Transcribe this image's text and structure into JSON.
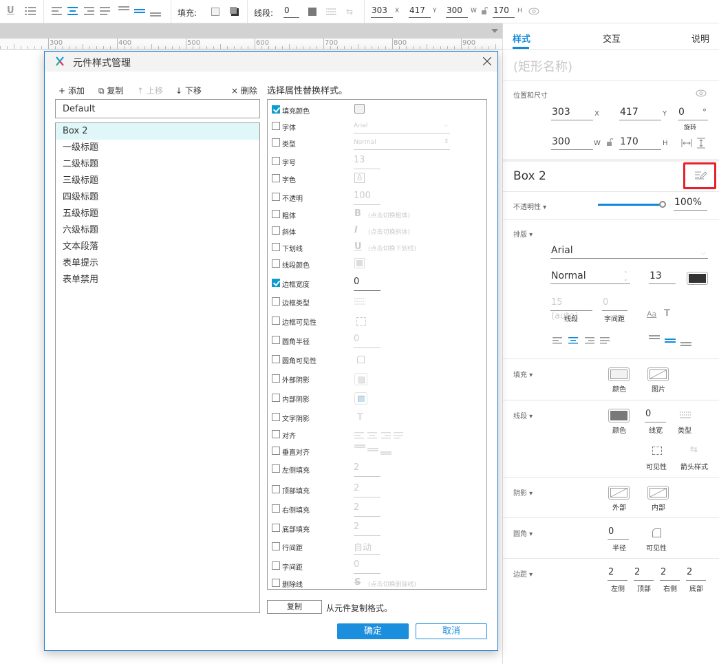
{
  "toolbar": {
    "fill_label": "填充:",
    "stroke_label": "线段:",
    "stroke_width": "0",
    "x": "303",
    "x_unit": "X",
    "y": "417",
    "y_unit": "Y",
    "w": "300",
    "w_unit": "W",
    "h": "170",
    "h_unit": "H"
  },
  "ruler": {
    "ticks": [
      "300",
      "400",
      "500",
      "600",
      "700",
      "800",
      "900"
    ]
  },
  "dialog": {
    "title": "元件样式管理",
    "tools": {
      "add": "+ 添加",
      "copy": "⧉ 复制",
      "up": "↑ 上移",
      "down": "↓ 下移",
      "delete": "× 删除"
    },
    "default_item": "Default",
    "styles": [
      "Box 2",
      "一级标题",
      "二级标题",
      "三级标题",
      "四级标题",
      "五级标题",
      "六级标题",
      "文本段落",
      "表单提示",
      "表单禁用"
    ],
    "selected_style": "Box 2",
    "prop_heading": "选择属性替换样式。",
    "props": [
      {
        "label": "填充颜色",
        "checked": true,
        "value": ""
      },
      {
        "label": "字体",
        "checked": false,
        "value": "Arial"
      },
      {
        "label": "类型",
        "checked": false,
        "value": "Normal"
      },
      {
        "label": "字号",
        "checked": false,
        "value": "13"
      },
      {
        "label": "字色",
        "checked": false,
        "value": ""
      },
      {
        "label": "不透明",
        "checked": false,
        "value": "100"
      },
      {
        "label": "粗体",
        "checked": false,
        "value": "(点击切换粗体)"
      },
      {
        "label": "斜体",
        "checked": false,
        "value": "(点击切换斜体)"
      },
      {
        "label": "下划线",
        "checked": false,
        "value": "(点击切换下划线)"
      },
      {
        "label": "线段颜色",
        "checked": false,
        "value": ""
      },
      {
        "label": "边框宽度",
        "checked": true,
        "value": "0"
      },
      {
        "label": "边框类型",
        "checked": false,
        "value": ""
      },
      {
        "label": "边框可见性",
        "checked": false,
        "value": ""
      },
      {
        "label": "圆角半径",
        "checked": false,
        "value": "0"
      },
      {
        "label": "圆角可见性",
        "checked": false,
        "value": ""
      },
      {
        "label": "外部阴影",
        "checked": false,
        "value": ""
      },
      {
        "label": "内部阴影",
        "checked": false,
        "value": ""
      },
      {
        "label": "文字阴影",
        "checked": false,
        "value": ""
      },
      {
        "label": "对齐",
        "checked": false,
        "value": ""
      },
      {
        "label": "垂直对齐",
        "checked": false,
        "value": ""
      },
      {
        "label": "左侧填充",
        "checked": false,
        "value": "2"
      },
      {
        "label": "顶部填充",
        "checked": false,
        "value": "2"
      },
      {
        "label": "右侧填充",
        "checked": false,
        "value": "2"
      },
      {
        "label": "底部填充",
        "checked": false,
        "value": "2"
      },
      {
        "label": "行间距",
        "checked": false,
        "value": "自动"
      },
      {
        "label": "字间距",
        "checked": false,
        "value": "0"
      },
      {
        "label": "删除线",
        "checked": false,
        "value": "(点击切换删除线)"
      }
    ],
    "copy_button": "复制",
    "copy_text": "从元件复制格式。",
    "ok": "确定",
    "cancel": "取消"
  },
  "panel": {
    "tabs": [
      "样式",
      "交互",
      "说明"
    ],
    "active_tab": "样式",
    "shape_name_placeholder": "(矩形名称)",
    "pos_size_label": "位置和尺寸",
    "x": "303",
    "y": "417",
    "rotation": "0",
    "w": "300",
    "h": "170",
    "x_unit": "X",
    "y_unit": "Y",
    "w_unit": "W",
    "h_unit": "H",
    "deg": "°",
    "rotate_label": "旋转",
    "style_name": "Box 2",
    "opacity_label": "不透明性 ▾",
    "opacity_value": "100%",
    "opacity_fraction": 1.0,
    "typography_label": "排版 ▾",
    "font": "Arial",
    "font_style": "Normal",
    "font_size": "13",
    "line_height": "15 (auto)",
    "letter_spacing": "0",
    "line_height_label": "线段",
    "letter_spacing_label": "字间距",
    "fill_label": "填充 ▾",
    "fill_color_label": "颜色",
    "fill_image_label": "图片",
    "stroke_label": "线段 ▾",
    "stroke_color_label": "颜色",
    "stroke_width": "0",
    "stroke_width_label": "线宽",
    "stroke_type_label": "类型",
    "stroke_visibility_label": "可见性",
    "arrow_style_label": "箭头样式",
    "shadow_label": "阴影 ▾",
    "shadow_outer_label": "外部",
    "shadow_inner_label": "内部",
    "corner_label": "圆角 ▾",
    "corner_radius": "0",
    "corner_radius_label": "半径",
    "corner_visibility_label": "可见性",
    "padding_label": "边距 ▾",
    "padding": [
      {
        "value": "2",
        "label": "左侧"
      },
      {
        "value": "2",
        "label": "顶部"
      },
      {
        "value": "2",
        "label": "右侧"
      },
      {
        "value": "2",
        "label": "底部"
      }
    ],
    "colors": {
      "accent": "#0f8ad8",
      "highlight_box": "#e8202a",
      "font_color": "#333333",
      "stroke_color": "#797979",
      "fill_color": "#f2f2f2"
    }
  }
}
